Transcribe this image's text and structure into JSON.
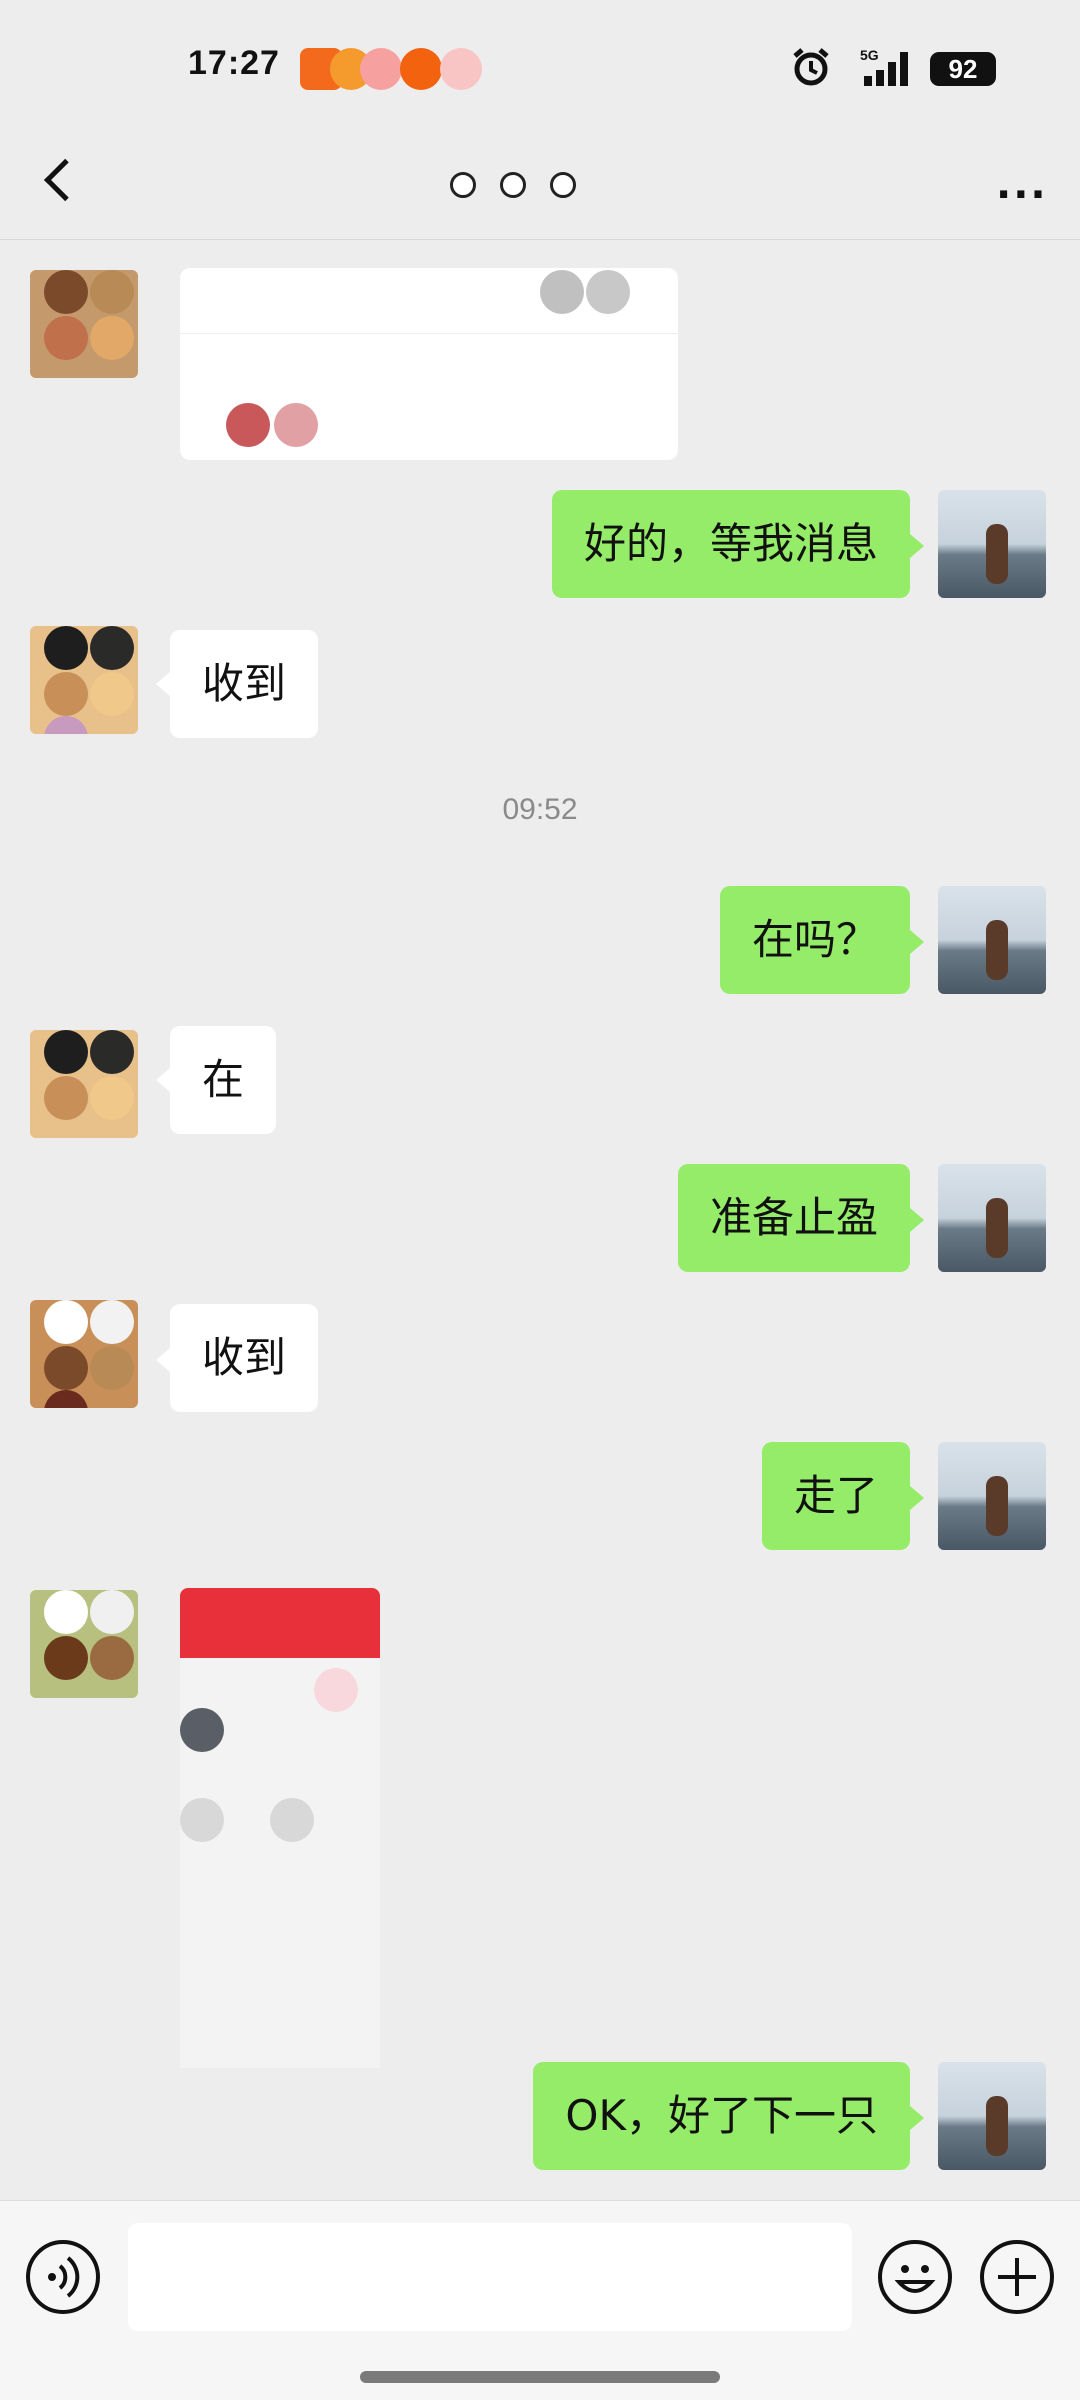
{
  "status_bar": {
    "time": "17:27",
    "network": "5G",
    "battery": "92"
  },
  "nav": {
    "back_icon": "chevron-left-icon",
    "more_icon": "ellipsis-icon",
    "more_label": "···"
  },
  "colors": {
    "outgoing_bubble": "#95ec69",
    "incoming_bubble": "#ffffff",
    "background": "#ededed"
  },
  "messages": {
    "m1": "好的，等我消息",
    "m2": "收到",
    "m3": "在吗？",
    "m4": "在",
    "m5": "准备止盈",
    "m6": "收到",
    "m7": "走了",
    "m8": "OK，好了下一只"
  },
  "timestamp": "09:52",
  "input": {
    "placeholder": ""
  }
}
